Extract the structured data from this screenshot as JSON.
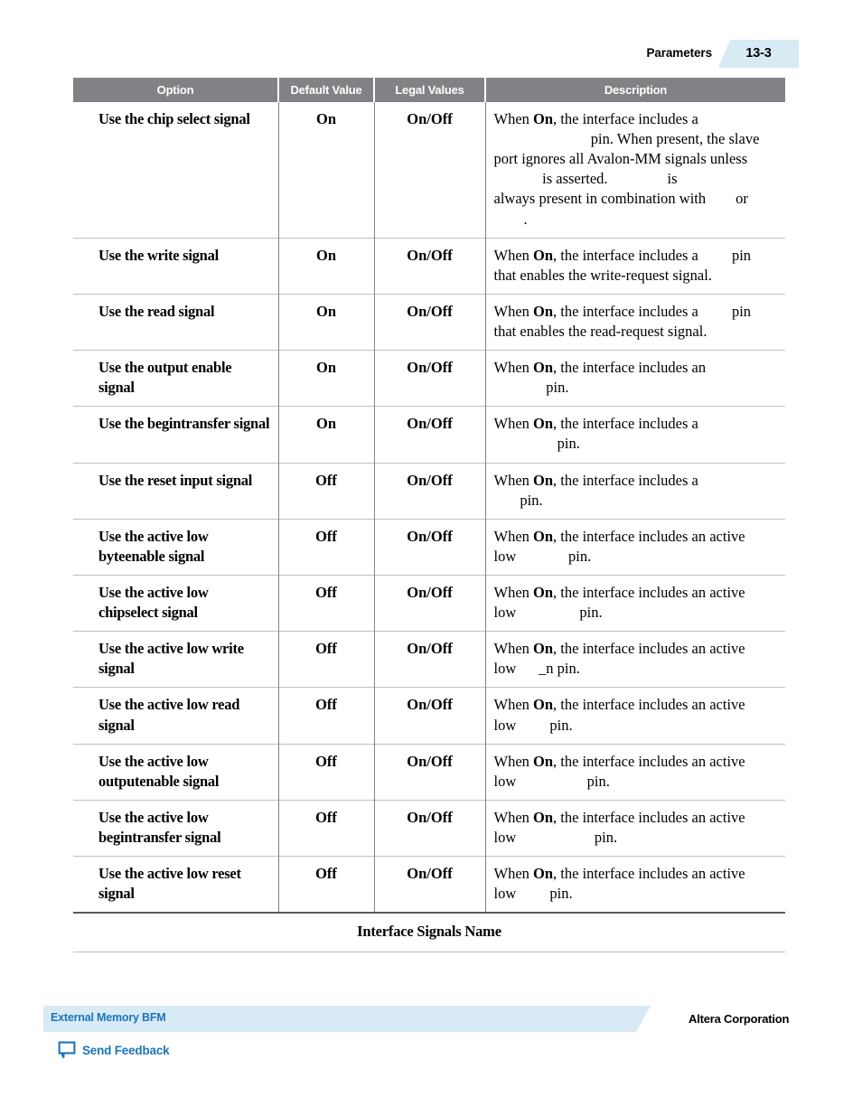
{
  "header": {
    "title": "Parameters",
    "page_number": "13-3"
  },
  "table": {
    "columns": [
      "Option",
      "Default Value",
      "Legal Values",
      "Description"
    ],
    "caption": "Interface Signals Name",
    "rows": [
      {
        "option": "Use the chip select signal",
        "default": "On",
        "legal": "On/Off",
        "desc_lines": [
          [
            {
              "t": "When ",
              "k": "n"
            },
            {
              "t": "On",
              "k": "b"
            },
            {
              "t": ", the interface includes a ",
              "k": "n"
            }
          ],
          [
            {
              "t": "                         ",
              "k": "s"
            },
            {
              "t": " pin. When present, the slave",
              "k": "n"
            }
          ],
          [
            {
              "t": "port ignores all Avalon-MM signals unless",
              "k": "n"
            }
          ],
          [
            {
              "t": "            ",
              "k": "s"
            },
            {
              "t": " is asserted. ",
              "k": "n"
            },
            {
              "t": "              ",
              "k": "s"
            },
            {
              "t": " is",
              "k": "n"
            }
          ],
          [
            {
              "t": "always present in combination with ",
              "k": "n"
            },
            {
              "t": "      ",
              "k": "s"
            },
            {
              "t": " or",
              "k": "n"
            }
          ],
          [
            {
              "t": "        ",
              "k": "s"
            },
            {
              "t": ".",
              "k": "n"
            }
          ]
        ]
      },
      {
        "option": "Use the write signal",
        "default": "On",
        "legal": "On/Off",
        "desc_lines": [
          [
            {
              "t": "When ",
              "k": "n"
            },
            {
              "t": "On",
              "k": "b"
            },
            {
              "t": ", the interface includes a ",
              "k": "n"
            },
            {
              "t": "       ",
              "k": "s"
            },
            {
              "t": " pin",
              "k": "n"
            }
          ],
          [
            {
              "t": "that enables the write-request signal.",
              "k": "n"
            }
          ]
        ]
      },
      {
        "option": "Use the read signal",
        "default": "On",
        "legal": "On/Off",
        "desc_lines": [
          [
            {
              "t": "When ",
              "k": "n"
            },
            {
              "t": "On",
              "k": "b"
            },
            {
              "t": ", the interface includes a ",
              "k": "n"
            },
            {
              "t": "       ",
              "k": "s"
            },
            {
              "t": " pin",
              "k": "n"
            }
          ],
          [
            {
              "t": "that enables the read-request signal.",
              "k": "n"
            }
          ]
        ]
      },
      {
        "option": "Use the output enable signal",
        "default": "On",
        "legal": "On/Off",
        "desc_lines": [
          [
            {
              "t": "When ",
              "k": "n"
            },
            {
              "t": "On",
              "k": "b"
            },
            {
              "t": ", the interface includes an",
              "k": "n"
            }
          ],
          [
            {
              "t": "             ",
              "k": "s"
            },
            {
              "t": " pin.",
              "k": "n"
            }
          ]
        ]
      },
      {
        "option": "Use the begintransfer signal",
        "default": "On",
        "legal": "On/Off",
        "desc_lines": [
          [
            {
              "t": "When ",
              "k": "n"
            },
            {
              "t": "On",
              "k": "b"
            },
            {
              "t": ", the interface includes a",
              "k": "n"
            }
          ],
          [
            {
              "t": "                ",
              "k": "s"
            },
            {
              "t": " pin.",
              "k": "n"
            }
          ]
        ]
      },
      {
        "option": "Use the reset input signal",
        "default": "Off",
        "legal": "On/Off",
        "desc_lines": [
          [
            {
              "t": "When ",
              "k": "n"
            },
            {
              "t": "On",
              "k": "b"
            },
            {
              "t": ", the interface includes a",
              "k": "n"
            }
          ],
          [
            {
              "t": "      ",
              "k": "s"
            },
            {
              "t": " pin.",
              "k": "n"
            }
          ]
        ]
      },
      {
        "option": "Use the active low byteenable signal",
        "default": "Off",
        "legal": "On/Off",
        "desc_lines": [
          [
            {
              "t": "When ",
              "k": "n"
            },
            {
              "t": "On",
              "k": "b"
            },
            {
              "t": ", the interface includes an active",
              "k": "n"
            }
          ],
          [
            {
              "t": "low ",
              "k": "n"
            },
            {
              "t": "            ",
              "k": "s"
            },
            {
              "t": " pin.",
              "k": "n"
            }
          ]
        ]
      },
      {
        "option": "Use the active low chipselect signal",
        "default": "Off",
        "legal": "On/Off",
        "desc_lines": [
          [
            {
              "t": "When ",
              "k": "n"
            },
            {
              "t": "On",
              "k": "b"
            },
            {
              "t": ", the interface includes an active",
              "k": "n"
            }
          ],
          [
            {
              "t": "low ",
              "k": "n"
            },
            {
              "t": "               ",
              "k": "s"
            },
            {
              "t": " pin.",
              "k": "n"
            }
          ]
        ]
      },
      {
        "option": "Use the active low write signal",
        "default": "Off",
        "legal": "On/Off",
        "desc_lines": [
          [
            {
              "t": "When ",
              "k": "n"
            },
            {
              "t": "On",
              "k": "b"
            },
            {
              "t": ", the interface includes an active",
              "k": "n"
            }
          ],
          [
            {
              "t": "low ",
              "k": "n"
            },
            {
              "t": "     ",
              "k": "s"
            },
            {
              "t": "_n pin.",
              "k": "n"
            }
          ]
        ]
      },
      {
        "option": "Use the active low read signal",
        "default": "Off",
        "legal": "On/Off",
        "desc_lines": [
          [
            {
              "t": "When ",
              "k": "n"
            },
            {
              "t": "On",
              "k": "b"
            },
            {
              "t": ", the interface includes an active",
              "k": "n"
            }
          ],
          [
            {
              "t": "low ",
              "k": "n"
            },
            {
              "t": "       ",
              "k": "s"
            },
            {
              "t": " pin.",
              "k": "n"
            }
          ]
        ]
      },
      {
        "option": "Use the active low outputenable signal",
        "default": "Off",
        "legal": "On/Off",
        "desc_lines": [
          [
            {
              "t": "When ",
              "k": "n"
            },
            {
              "t": "On",
              "k": "b"
            },
            {
              "t": ", the interface includes an active",
              "k": "n"
            }
          ],
          [
            {
              "t": "low ",
              "k": "n"
            },
            {
              "t": "                 ",
              "k": "s"
            },
            {
              "t": " pin.",
              "k": "n"
            }
          ]
        ]
      },
      {
        "option": "Use the active low begintransfer signal",
        "default": "Off",
        "legal": "On/Off",
        "desc_lines": [
          [
            {
              "t": "When ",
              "k": "n"
            },
            {
              "t": "On",
              "k": "b"
            },
            {
              "t": ", the interface includes an active",
              "k": "n"
            }
          ],
          [
            {
              "t": "low ",
              "k": "n"
            },
            {
              "t": "                   ",
              "k": "s"
            },
            {
              "t": " pin.",
              "k": "n"
            }
          ]
        ]
      },
      {
        "option": "Use the active low reset signal",
        "default": "Off",
        "legal": "On/Off",
        "desc_lines": [
          [
            {
              "t": "When ",
              "k": "n"
            },
            {
              "t": "On",
              "k": "b"
            },
            {
              "t": ", the interface includes an active",
              "k": "n"
            }
          ],
          [
            {
              "t": "low ",
              "k": "n"
            },
            {
              "t": "       ",
              "k": "s"
            },
            {
              "t": " pin.",
              "k": "n"
            }
          ]
        ]
      }
    ]
  },
  "footer": {
    "document_title": "External Memory BFM",
    "corporation": "Altera Corporation",
    "feedback_label": "Send Feedback",
    "feedback_icon": "speech-bubble-icon"
  },
  "colors": {
    "table_header_bg": "#808285",
    "accent_light_blue": "#d8eaf4",
    "link_blue": "#1b75bb",
    "rule_gray": "#bcbec0"
  }
}
